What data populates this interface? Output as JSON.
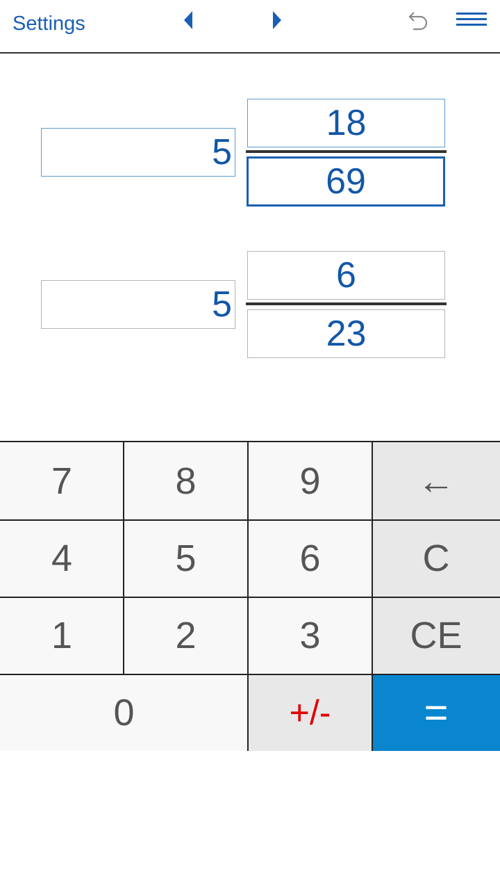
{
  "toolbar": {
    "settings_label": "Settings",
    "icons": {
      "prev": "caret-left-icon",
      "next": "caret-right-icon",
      "undo": "undo-icon",
      "menu": "menu-icon"
    },
    "accent_color": "#1a5fb4"
  },
  "fraction1": {
    "whole": "5",
    "numerator": "18",
    "denominator": "69",
    "active_field": "denominator"
  },
  "fraction2": {
    "whole": "5",
    "numerator": "6",
    "denominator": "23"
  },
  "keypad": {
    "k7": "7",
    "k8": "8",
    "k9": "9",
    "backspace": "←",
    "k4": "4",
    "k5": "5",
    "k6": "6",
    "clear": "C",
    "k1": "1",
    "k2": "2",
    "k3": "3",
    "clear_entry": "CE",
    "k0": "0",
    "sign": "+/-",
    "equals": "=",
    "colors": {
      "digit_bg": "#f8f8f8",
      "function_bg": "#e8e8e8",
      "sign_text": "#e00000",
      "equals_bg": "#0a86cf"
    }
  }
}
